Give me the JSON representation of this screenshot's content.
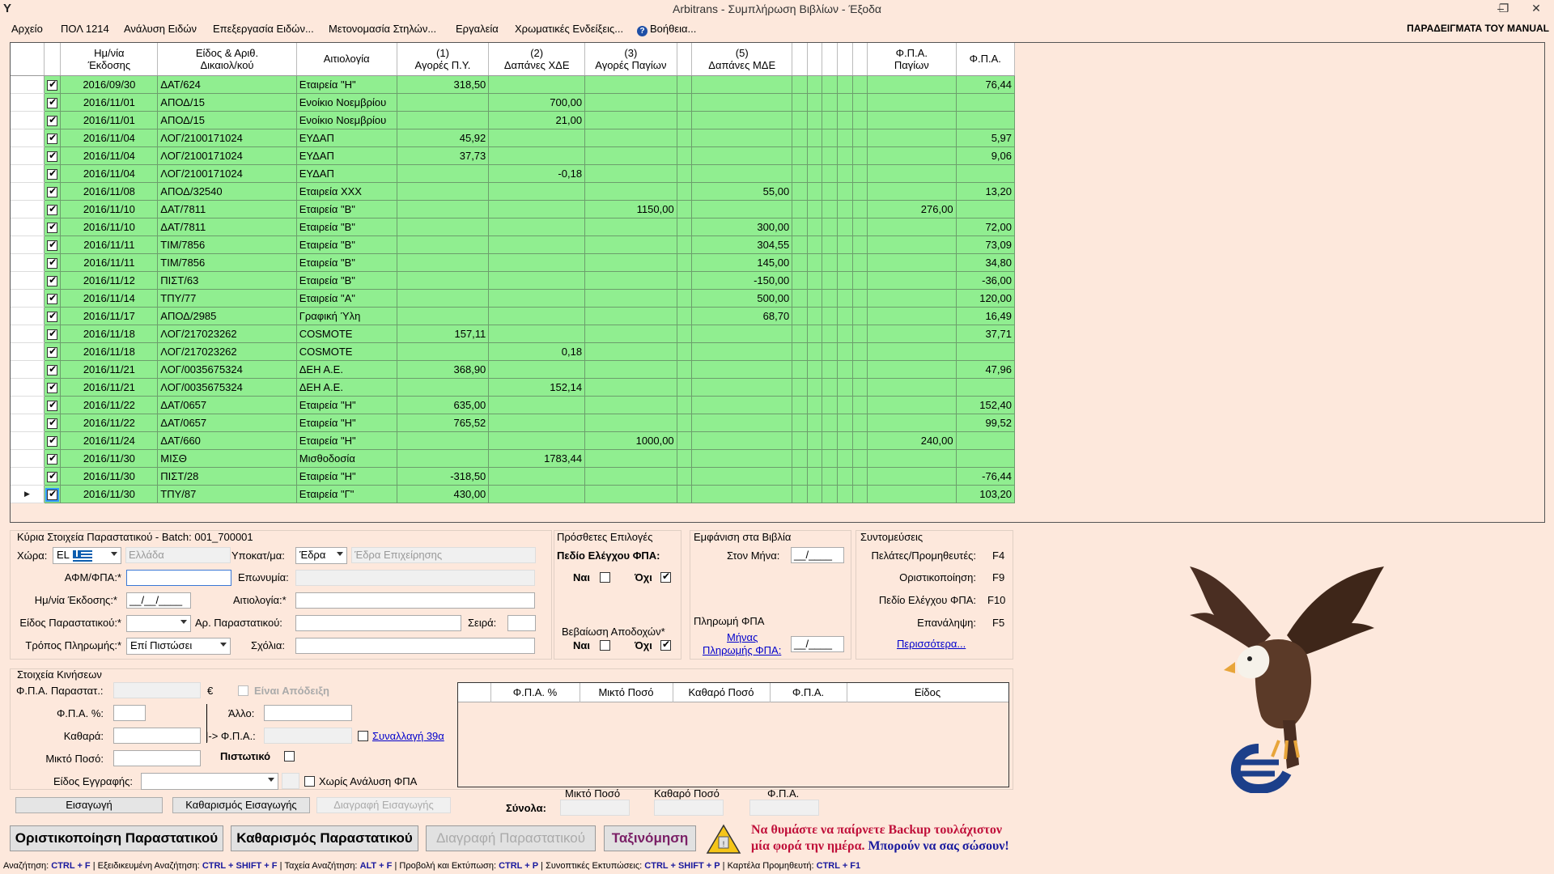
{
  "window": {
    "title": "Arbitrans - Συμπλήρωση Βιβλίων - Έξοδα",
    "logo": "Y",
    "restore_glyph": "❐",
    "close_glyph": "✕",
    "minimize_glyph": "–"
  },
  "menu": {
    "items": [
      "Αρχείο",
      "ΠΟΛ 1214",
      "Ανάλυση Ειδών",
      "Επεξεργασία Ειδών...",
      "Μετονομασία Στηλών...",
      "Εργαλεία",
      "Χρωματικές Ενδείξεις...",
      "Βοήθεια..."
    ],
    "help_icon": "?",
    "manual": "ΠΑΡΑΔΕΙΓΜΑΤΑ ΤΟΥ MANUAL"
  },
  "grid": {
    "headers": [
      "Ημ/νία\nΈκδοσης",
      "Είδος & Αριθ.\nΔικαιολ/κού",
      "Αιτιολογία",
      "(1)\nΑγορές Π.Υ.",
      "(2)\nΔαπάνες ΧΔΕ",
      "(3)\nΑγορές Παγίων",
      "",
      "(5)\nΔαπάνες ΜΔΕ",
      "",
      "",
      "",
      "",
      "",
      "Φ.Π.Α.\nΠαγίων",
      "Φ.Π.Α."
    ],
    "rows": [
      [
        "2016/09/30",
        "ΔΑΤ/624",
        "Εταιρεία \"Η\"",
        "318,50",
        "",
        "",
        "",
        "",
        "76,44"
      ],
      [
        "2016/11/01",
        "ΑΠΟΔ/15",
        "Ενοίκιο Νοεμβρίου",
        "",
        "700,00",
        "",
        "",
        "",
        ""
      ],
      [
        "2016/11/01",
        "ΑΠΟΔ/15",
        "Ενοίκιο Νοεμβρίου",
        "",
        "21,00",
        "",
        "",
        "",
        ""
      ],
      [
        "2016/11/04",
        "ΛΟΓ/2100171024",
        "ΕΥΔΑΠ",
        "45,92",
        "",
        "",
        "",
        "",
        "5,97"
      ],
      [
        "2016/11/04",
        "ΛΟΓ/2100171024",
        "ΕΥΔΑΠ",
        "37,73",
        "",
        "",
        "",
        "",
        "9,06"
      ],
      [
        "2016/11/04",
        "ΛΟΓ/2100171024",
        "ΕΥΔΑΠ",
        "",
        "-0,18",
        "",
        "",
        "",
        ""
      ],
      [
        "2016/11/08",
        "ΑΠΟΔ/32540",
        "Εταιρεία ΧΧΧ",
        "",
        "",
        "",
        "55,00",
        "",
        "13,20"
      ],
      [
        "2016/11/10",
        "ΔΑΤ/7811",
        "Εταιρεία \"Β\"",
        "",
        "",
        "1150,00",
        "",
        "276,00",
        ""
      ],
      [
        "2016/11/10",
        "ΔΑΤ/7811",
        "Εταιρεία \"Β\"",
        "",
        "",
        "",
        "300,00",
        "",
        "72,00"
      ],
      [
        "2016/11/11",
        "ΤΙΜ/7856",
        "Εταιρεία \"Β\"",
        "",
        "",
        "",
        "304,55",
        "",
        "73,09"
      ],
      [
        "2016/11/11",
        "ΤΙΜ/7856",
        "Εταιρεία \"Β\"",
        "",
        "",
        "",
        "145,00",
        "",
        "34,80"
      ],
      [
        "2016/11/12",
        "ΠΙΣΤ/63",
        "Εταιρεία \"Β\"",
        "",
        "",
        "",
        "-150,00",
        "",
        "-36,00"
      ],
      [
        "2016/11/14",
        "ΤΠΥ/77",
        "Εταιρεία \"Α\"",
        "",
        "",
        "",
        "500,00",
        "",
        "120,00"
      ],
      [
        "2016/11/17",
        "ΑΠΟΔ/2985",
        "Γραφική Ύλη",
        "",
        "",
        "",
        "68,70",
        "",
        "16,49"
      ],
      [
        "2016/11/18",
        "ΛΟΓ/217023262",
        "COSMOTE",
        "157,11",
        "",
        "",
        "",
        "",
        "37,71"
      ],
      [
        "2016/11/18",
        "ΛΟΓ/217023262",
        "COSMOTE",
        "",
        "0,18",
        "",
        "",
        "",
        ""
      ],
      [
        "2016/11/21",
        "ΛΟΓ/0035675324",
        "ΔΕΗ Α.Ε.",
        "368,90",
        "",
        "",
        "",
        "",
        "47,96"
      ],
      [
        "2016/11/21",
        "ΛΟΓ/0035675324",
        "ΔΕΗ Α.Ε.",
        "",
        "152,14",
        "",
        "",
        "",
        ""
      ],
      [
        "2016/11/22",
        "ΔΑΤ/0657",
        "Εταιρεία \"Η\"",
        "635,00",
        "",
        "",
        "",
        "",
        "152,40"
      ],
      [
        "2016/11/22",
        "ΔΑΤ/0657",
        "Εταιρεία \"Η\"",
        "765,52",
        "",
        "",
        "",
        "",
        "99,52"
      ],
      [
        "2016/11/24",
        "ΔΑΤ/660",
        "Εταιρεία \"Η\"",
        "",
        "",
        "1000,00",
        "",
        "240,00",
        ""
      ],
      [
        "2016/11/30",
        "ΜΙΣΘ",
        "Μισθοδοσία",
        "",
        "1783,44",
        "",
        "",
        "",
        ""
      ],
      [
        "2016/11/30",
        "ΠΙΣΤ/28",
        "Εταιρεία \"Η\"",
        "-318,50",
        "",
        "",
        "",
        "",
        "-76,44"
      ],
      [
        "2016/11/30",
        "ΤΠΥ/87",
        "Εταιρεία \"Γ\"",
        "430,00",
        "",
        "",
        "",
        "",
        "103,20"
      ]
    ],
    "current_row_marker": "▶"
  },
  "main_doc": {
    "title": "Κύρια Στοιχεία Παραστατικού - Batch: 001_700001",
    "country_label": "Χώρα:",
    "country_code": "EL",
    "country_name_placeholder": "Ελλάδα",
    "branch_label": "Υποκατ/μα:",
    "branch_value": "Έδρα",
    "branch_placeholder": "Έδρα Επιχείρησης",
    "afm_label": "ΑΦΜ/ΦΠΑ:*",
    "name_label": "Επωνυμία:",
    "date_label": "Ημ/νία Έκδοσης:*",
    "date_value": "__/__/____",
    "reason_label": "Αιτιολογία:*",
    "doctype_label": "Είδος Παραστατικού:*",
    "docnum_label": "Αρ. Παραστατικού:",
    "series_label": "Σειρά:",
    "payment_label": "Τρόπος Πληρωμής:*",
    "payment_value": "Επί Πιστώσει",
    "comments_label": "Σχόλια:"
  },
  "extra_options": {
    "title": "Πρόσθετες Επιλογές",
    "vat_check_label": "Πεδίο Ελέγχου ΦΠΑ:",
    "yes": "Ναι",
    "no": "Όχι",
    "withholding_label": "Βεβαίωση Αποδοχών*"
  },
  "books_display": {
    "title": "Εμφάνιση στα Βιβλία",
    "month_label": "Στον Μήνα:",
    "month_value": "__/____",
    "vat_payment_title": "Πληρωμή ΦΠΑ",
    "vat_month_link_1": "Μήνας",
    "vat_month_link_2": "Πληρωμής ΦΠΑ:",
    "vat_month_value": "__/____"
  },
  "shortcuts": {
    "title": "Συντομεύσεις",
    "items": [
      {
        "label": "Πελάτες/Προμηθευτές:",
        "key": "F4"
      },
      {
        "label": "Οριστικοποίηση:",
        "key": "F9"
      },
      {
        "label": "Πεδίο Ελέγχου ΦΠΑ:",
        "key": "F10"
      },
      {
        "label": "Επανάληψη:",
        "key": "F5"
      }
    ],
    "more_link": "Περισσότερα..."
  },
  "movements": {
    "title": "Στοιχεία Κινήσεων",
    "vat_doc_label": "Φ.Π.Α. Παραστατ.:",
    "euro": "€",
    "receipt_label": "Είναι Απόδειξη",
    "vat_pct_label": "Φ.Π.Α. %:",
    "other_label": "Άλλο:",
    "net_label": "Καθαρά:",
    "arrow_vat_label": "|-> Φ.Π.Α.:",
    "transaction_link": "Συναλλαγή 39α",
    "gross_label": "Μικτό Ποσό:",
    "credit_label": "Πιστωτικό",
    "entry_type_label": "Είδος Εγγραφής:",
    "no_vat_analysis_label": "Χωρίς Ανάλυση ΦΠΑ",
    "btn_insert": "Εισαγωγή",
    "btn_clear_insert": "Καθαρισμός Εισαγωγής",
    "btn_delete_insert": "Διαγραφή Εισαγωγής"
  },
  "sub_grid": {
    "headers": [
      "Φ.Π.Α. %",
      "Μικτό Ποσό",
      "Καθαρό Ποσό",
      "Φ.Π.Α.",
      "Είδος"
    ]
  },
  "totals": {
    "label": "Σύνολα:",
    "gross": "Μικτό Ποσό",
    "net": "Καθαρό Ποσό",
    "vat": "Φ.Π.Α."
  },
  "actions": {
    "finalize": "Οριστικοποίηση Παραστατικού",
    "clear": "Καθαρισμός Παραστατικού",
    "delete": "Διαγραφή Παραστατικού",
    "sort": "Ταξινόμηση"
  },
  "backup_notice": {
    "line1": "Να θυμάστε να παίρνετε Backup τουλάχιστον",
    "line2_red": "μία φορά την ημέρα. ",
    "line2_blue": "Μπορούν να σας σώσουν!",
    "warning_icon": "warning-icon"
  },
  "statusbar": [
    {
      "label": "Αναζήτηση:",
      "key": "CTRL + F"
    },
    {
      "label": "Εξειδικευμένη Αναζήτηση:",
      "key": "CTRL + SHIFT + F"
    },
    {
      "label": "Ταχεία Αναζήτηση:",
      "key": "ALT + F"
    },
    {
      "label": "Προβολή και Εκτύπωση:",
      "key": "CTRL + P"
    },
    {
      "label": "Συνοπτικές Εκτυπώσεις:",
      "key": "CTRL + SHIFT + P"
    },
    {
      "label": "Καρτέλα Προμηθευτή:",
      "key": "CTRL + F1"
    }
  ],
  "colors": {
    "row_green": "#90ee90",
    "background": "#fde8dc",
    "link_blue": "#0000cc",
    "backup_red": "#c0103a",
    "backup_blue": "#1a1a9e"
  }
}
